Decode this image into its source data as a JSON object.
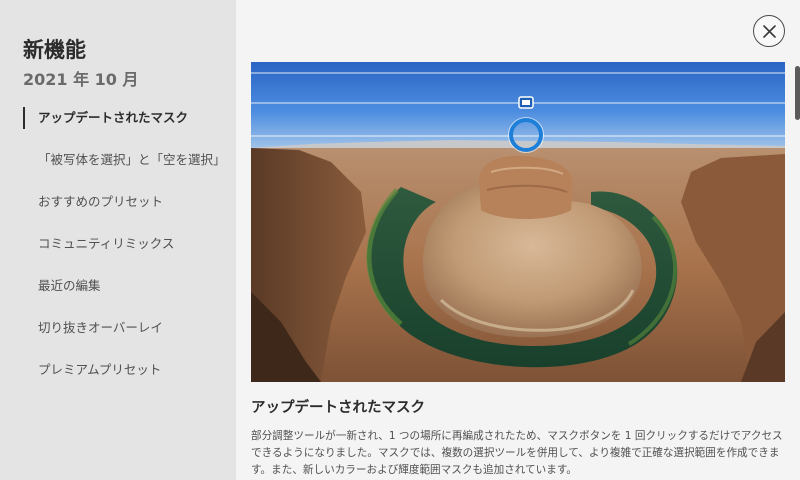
{
  "sidebar": {
    "title": "新機能",
    "date": "2021 年 10 月",
    "items": [
      {
        "label": "アップデートされたマスク"
      },
      {
        "label": "「被写体を選択」と「空を選択」"
      },
      {
        "label": "おすすめのプリセット"
      },
      {
        "label": "コミュニティリミックス"
      },
      {
        "label": "最近の編集"
      },
      {
        "label": "切り抜きオーバーレイ"
      },
      {
        "label": "プレミアムプリセット"
      }
    ],
    "active_index": 0
  },
  "main": {
    "hero_image": "horseshoe-bend-canyon-photo",
    "section_title": "アップデートされたマスク",
    "section_body": "部分調整ツールが一新され、1 つの場所に再編成されたため、マスクボタンを 1 回クリックするだけでアクセスできるようになりました。マスクでは、複数の選択ツールを併用して、より複雑で正確な選択範囲を作成できます。また、新しいカラーおよび輝度範囲マスクも追加されています。"
  },
  "icons": {
    "close": "close-icon",
    "gradient_handle": "gradient-handle-icon",
    "gradient_pin": "gradient-pin-icon"
  },
  "colors": {
    "sidebar_bg": "#e4e4e4",
    "main_bg": "#f4f4f4",
    "accent_blue": "#1e7fd8"
  }
}
